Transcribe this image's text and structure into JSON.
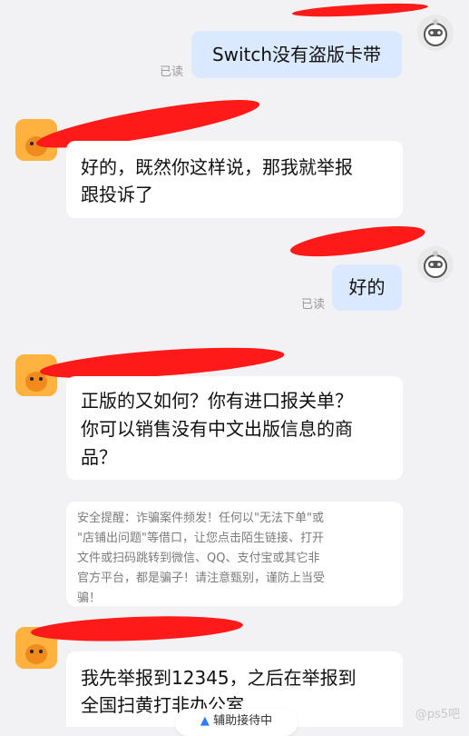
{
  "messages": [
    {
      "id": "m1",
      "side": "out",
      "text": "Switch没有盗版卡带",
      "read": "已读"
    },
    {
      "id": "m2",
      "side": "in",
      "line1": "好的，既然你这样说，那我就举报",
      "line2": "跟投诉了"
    },
    {
      "id": "m3",
      "side": "out",
      "text": "好的",
      "read": "已读"
    },
    {
      "id": "m4",
      "side": "in",
      "line1": "正版的又如何？你有进口报关单？",
      "line2": "你可以销售没有中文出版信息的商",
      "line3": "品？"
    },
    {
      "id": "m5",
      "side": "in",
      "line1": "我先举报到12345，之后在举报到",
      "line2": "全国扫黄打非办公室"
    }
  ],
  "safety_notice": {
    "line1": "安全提醒：诈骗案件频发！任何以\"无法下单\"或",
    "line2": "\"店铺出问题\"等借口，让您点击陌生链接、打开",
    "line3": "文件或扫码跳转到微信、QQ、支付宝或其它非",
    "line4": "官方平台，都是骗子！请注意甄别，谨防上当受",
    "line5": "骗！"
  },
  "bottom_bar": {
    "label": "辅助接待中"
  },
  "watermark": "@ps5吧",
  "colors": {
    "out_bubble": "#dbe9ff",
    "in_bubble": "#ffffff",
    "background": "#f2f2f4",
    "redaction": "#ff1a1a",
    "shop_avatar": "#ffb23f"
  }
}
